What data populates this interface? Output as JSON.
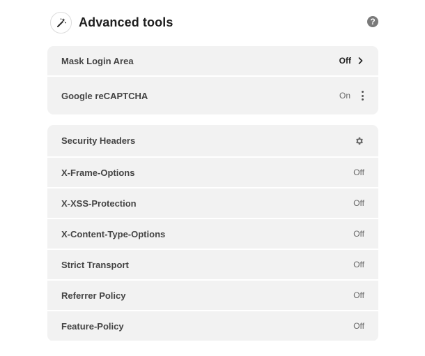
{
  "header": {
    "title": "Advanced tools",
    "icon": "magic-wand-icon",
    "help_icon_glyph": "?"
  },
  "general": {
    "items": [
      {
        "label": "Mask Login Area",
        "value": "Off",
        "control": "chevron-right-icon"
      },
      {
        "label": "Google reCAPTCHA",
        "value": "On",
        "control": "kebab-menu-icon"
      }
    ]
  },
  "security_headers": {
    "title": "Security Headers",
    "settings_icon": "gear-icon",
    "items": [
      {
        "label": "X-Frame-Options",
        "value": "Off"
      },
      {
        "label": "X-XSS-Protection",
        "value": "Off"
      },
      {
        "label": "X-Content-Type-Options",
        "value": "Off"
      },
      {
        "label": "Strict Transport",
        "value": "Off"
      },
      {
        "label": "Referrer Policy",
        "value": "Off"
      },
      {
        "label": "Feature-Policy",
        "value": "Off"
      }
    ]
  },
  "colors": {
    "row_bg": "#f2f2f2",
    "text": "#444444",
    "muted": "#6b6b6b"
  }
}
